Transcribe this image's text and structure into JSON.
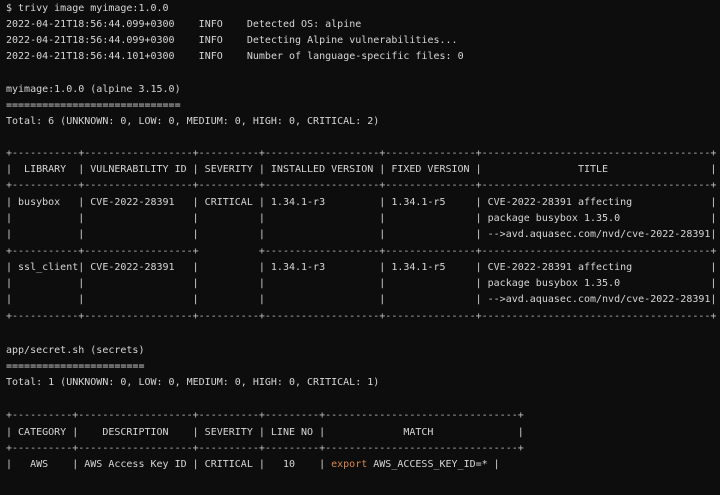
{
  "command": "$ trivy image myimage:1.0.0",
  "log": [
    {
      "ts": "2022-04-21T18:56:44.099+0300",
      "level": "INFO",
      "msg": "Detected OS: alpine"
    },
    {
      "ts": "2022-04-21T18:56:44.099+0300",
      "level": "INFO",
      "msg": "Detecting Alpine vulnerabilities..."
    },
    {
      "ts": "2022-04-21T18:56:44.101+0300",
      "level": "INFO",
      "msg": "Number of language-specific files: 0"
    }
  ],
  "image_section": {
    "target": "myimage:1.0.0 (alpine 3.15.0)",
    "underline": "=============================",
    "total": "Total: 6 (UNKNOWN: 0, LOW: 0, MEDIUM: 0, HIGH: 0, CRITICAL: 2)",
    "table_lines": [
      "+-----------+------------------+----------+-------------------+---------------+--------------------------------------+",
      "|  LIBRARY  | VULNERABILITY ID | SEVERITY | INSTALLED VERSION | FIXED VERSION |                TITLE                 |",
      "+-----------+------------------+----------+-------------------+---------------+--------------------------------------+",
      "| busybox   | CVE-2022-28391   | CRITICAL | 1.34.1-r3         | 1.34.1-r5     | CVE-2022-28391 affecting             |",
      "|           |                  |          |                   |               | package busybox 1.35.0               |",
      "|           |                  |          |                   |               | -->avd.aquasec.com/nvd/cve-2022-28391|",
      "+-----------+------------------+          +-------------------+---------------+--------------------------------------+",
      "| ssl_client| CVE-2022-28391   |          | 1.34.1-r3         | 1.34.1-r5     | CVE-2022-28391 affecting             |",
      "|           |                  |          |                   |               | package busybox 1.35.0               |",
      "|           |                  |          |                   |               | -->avd.aquasec.com/nvd/cve-2022-28391|",
      "+-----------+------------------+----------+-------------------+---------------+--------------------------------------+"
    ]
  },
  "secrets_section": {
    "target": "app/secret.sh (secrets)",
    "underline": "=======================",
    "total": "Total: 1 (UNKNOWN: 0, LOW: 0, MEDIUM: 0, HIGH: 0, CRITICAL: 1)",
    "table_lines": [
      "+----------+-------------------+----------+---------+--------------------------------+",
      "| CATEGORY |    DESCRIPTION    | SEVERITY | LINE NO |             MATCH              |",
      "+----------+-------------------+----------+---------+--------------------------------+"
    ],
    "row_pre": "|   AWS    | AWS Access Key ID | CRITICAL |   10    | ",
    "row_export": "export",
    "row_post": " AWS_ACCESS_KEY_ID=* |"
  },
  "colors": {
    "background": "#0d0d0d",
    "text": "#d6d6d6",
    "keyword": "#d9894a"
  }
}
